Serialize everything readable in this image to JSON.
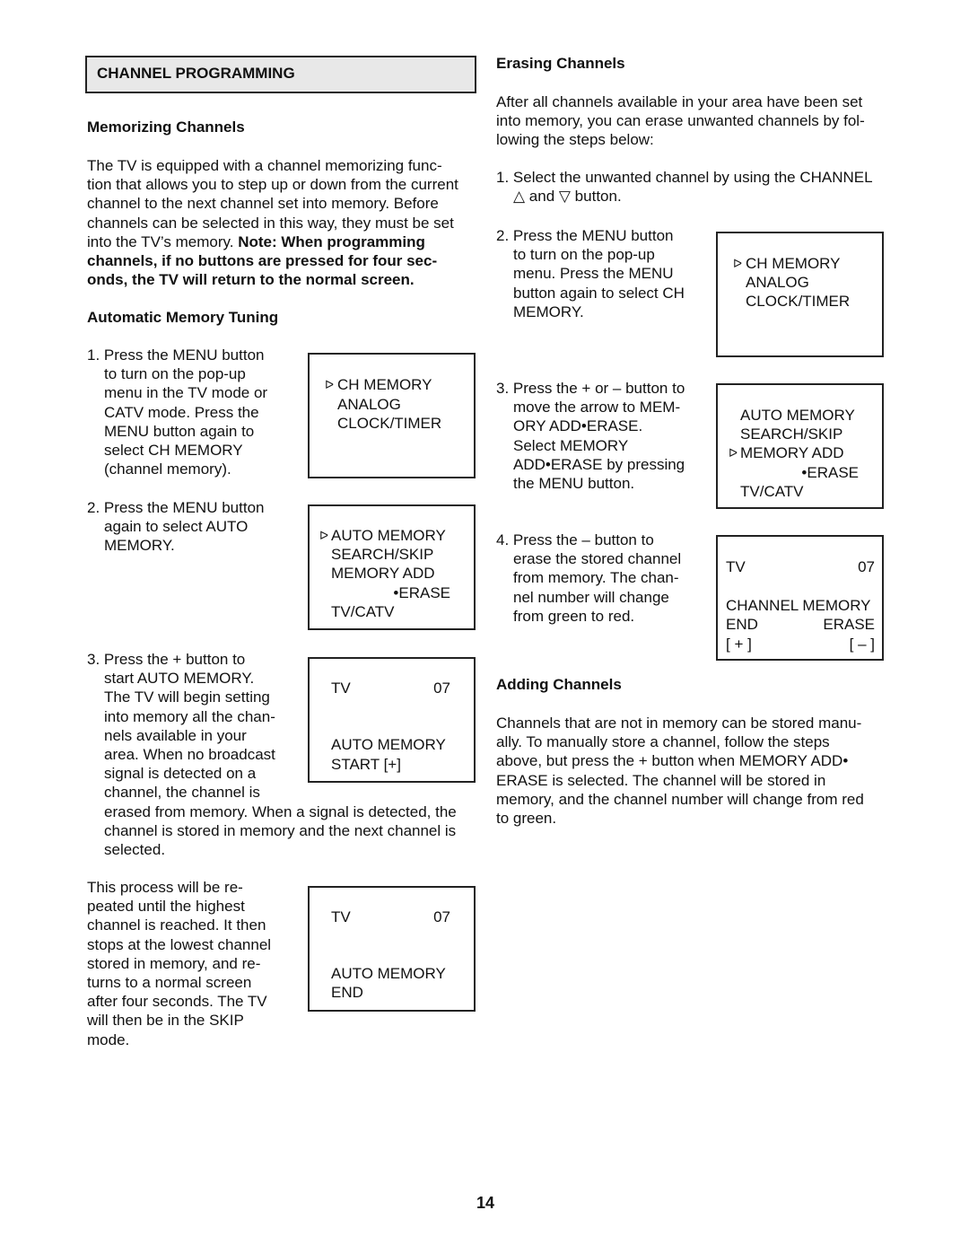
{
  "title": "CHANNEL PROGRAMMING",
  "memorizing": {
    "heading": "Memorizing Channels",
    "lines": [
      "The TV is equipped with a channel memorizing func-",
      "tion that allows you to step up or down from the current",
      "channel to the next channel set into memory. Before",
      "channels can be selected in this way, they must be set",
      [
        [
          "into the TV’s memory. ",
          false
        ],
        [
          "Note: When programming",
          true
        ]
      ],
      [
        [
          "channels, if no buttons are pressed for four sec-",
          true
        ]
      ],
      [
        [
          "onds, the TV will return to the normal screen.",
          true
        ]
      ]
    ]
  },
  "auto_tuning": {
    "heading": "Automatic Memory Tuning",
    "step1": [
      "1. Press the MENU button",
      "to turn on the pop-up",
      "menu in the TV mode or",
      "CATV mode. Press the",
      "MENU button again to",
      "select CH MEMORY",
      "(channel memory)."
    ],
    "step2": [
      "2. Press the MENU button",
      "again to select AUTO",
      "MEMORY."
    ],
    "step3": [
      "3. Press the + button to",
      "start AUTO MEMORY.",
      "The TV will begin setting",
      "into memory all the chan-",
      "nels available in your",
      "area. When no broadcast",
      "signal is detected on a",
      "channel, the channel is",
      "erased from memory. When a signal is detected, the",
      "channel is stored in memory and the next channel is",
      "selected."
    ],
    "process": [
      "This process will be re-",
      "peated until the highest",
      "channel is reached. It then",
      "stops at the lowest channel",
      "stored in memory, and re-",
      "turns to a normal screen",
      "after four seconds. The TV",
      "will then be in the SKIP",
      "mode."
    ]
  },
  "erasing": {
    "heading": "Erasing Channels",
    "intro": [
      "After all channels available in your area have been set",
      "into memory, you can erase unwanted channels by fol-",
      "lowing the steps below:"
    ],
    "step1": [
      "1. Select the unwanted channel by using the CHANNEL",
      "△ and ▽ button."
    ],
    "step2": [
      "2. Press the MENU button",
      "to turn on the pop-up",
      "menu. Press the MENU",
      "button again to select CH",
      "MEMORY."
    ],
    "step3": [
      "3. Press the + or – button to",
      "move the arrow to MEM-",
      "ORY ADD•ERASE.",
      "Select MEMORY",
      "ADD•ERASE by pressing",
      "the MENU button."
    ],
    "step4": [
      "4. Press the – button to",
      "erase the stored channel",
      "from memory. The chan-",
      "nel number will change",
      "from green to red."
    ]
  },
  "adding": {
    "heading": "Adding Channels",
    "lines": [
      "Channels that are not in memory can be stored manu-",
      "ally. To manually store a channel, follow the steps",
      "above, but press the + button when MEMORY ADD•",
      "ERASE is selected. The channel will be stored in",
      "memory, and the channel number will change from red",
      "to green."
    ]
  },
  "screens": {
    "menu1": {
      "pointer_icon": "triangle-right",
      "items": [
        "CH MEMORY",
        "ANALOG",
        "CLOCK/TIMER"
      ]
    },
    "menu2": {
      "items": [
        "AUTO MEMORY",
        "SEARCH/SKIP",
        "MEMORY ADD",
        "•ERASE",
        "TV/CATV"
      ]
    },
    "auto_start": {
      "tv": "TV",
      "channel": "07",
      "line1": "AUTO MEMORY",
      "line2": "START [+]"
    },
    "auto_end": {
      "tv": "TV",
      "channel": "07",
      "line1": "AUTO MEMORY",
      "line2": "END"
    },
    "erase_menu1": {
      "items": [
        "CH MEMORY",
        "ANALOG",
        "CLOCK/TIMER"
      ]
    },
    "erase_menu2": {
      "items": [
        "AUTO MEMORY",
        "SEARCH/SKIP",
        "MEMORY ADD",
        "•ERASE",
        "TV/CATV"
      ]
    },
    "erase_screen": {
      "tv": "TV",
      "channel": "07",
      "line1": "CHANNEL MEMORY",
      "end": "END",
      "erase": "ERASE",
      "plus": "[ + ]",
      "minus": "[ – ]"
    }
  },
  "page_number": "14"
}
